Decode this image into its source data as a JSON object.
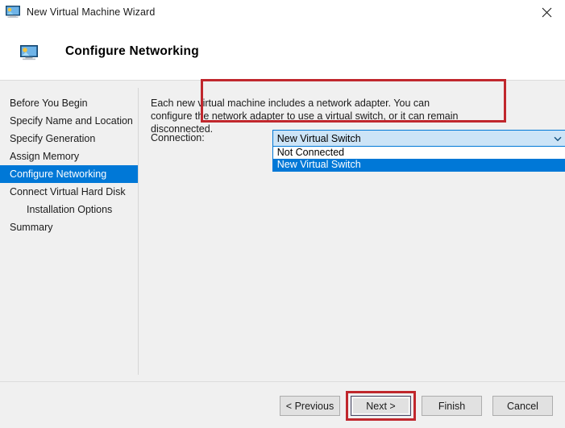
{
  "window": {
    "title": "New Virtual Machine Wizard",
    "title_icon": "virtual-machine-monitor-icon",
    "close_icon": "close-icon"
  },
  "header": {
    "icon": "virtual-machine-monitor-icon",
    "title": "Configure Networking"
  },
  "sidebar": {
    "items": [
      {
        "label": "Before You Begin",
        "selected": false,
        "indent": false
      },
      {
        "label": "Specify Name and Location",
        "selected": false,
        "indent": false
      },
      {
        "label": "Specify Generation",
        "selected": false,
        "indent": false
      },
      {
        "label": "Assign Memory",
        "selected": false,
        "indent": false
      },
      {
        "label": "Configure Networking",
        "selected": true,
        "indent": false
      },
      {
        "label": "Connect Virtual Hard Disk",
        "selected": false,
        "indent": false
      },
      {
        "label": "Installation Options",
        "selected": false,
        "indent": true
      },
      {
        "label": "Summary",
        "selected": false,
        "indent": false
      }
    ]
  },
  "main": {
    "description": "Each new virtual machine includes a network adapter. You can configure the network adapter to use a virtual switch, or it can remain disconnected.",
    "connection": {
      "label": "Connection:",
      "selected_value": "New Virtual Switch",
      "expanded": true,
      "arrow_icon": "chevron-down-icon",
      "options": [
        {
          "label": "Not Connected",
          "highlighted": false
        },
        {
          "label": "New Virtual Switch",
          "highlighted": true
        }
      ]
    }
  },
  "footer": {
    "buttons": [
      {
        "label": "< Previous",
        "focused": false,
        "highlighted": false
      },
      {
        "label": "Next >",
        "focused": true,
        "highlighted": true
      },
      {
        "label": "Finish",
        "focused": false,
        "highlighted": false
      },
      {
        "label": "Cancel",
        "focused": false,
        "highlighted": false
      }
    ]
  },
  "colors": {
    "accent": "#0078d7",
    "annotation": "#c0272d",
    "combo_fill": "#cce4f7",
    "window_bg": "#f0f0f0",
    "button_face": "#e1e1e1"
  }
}
